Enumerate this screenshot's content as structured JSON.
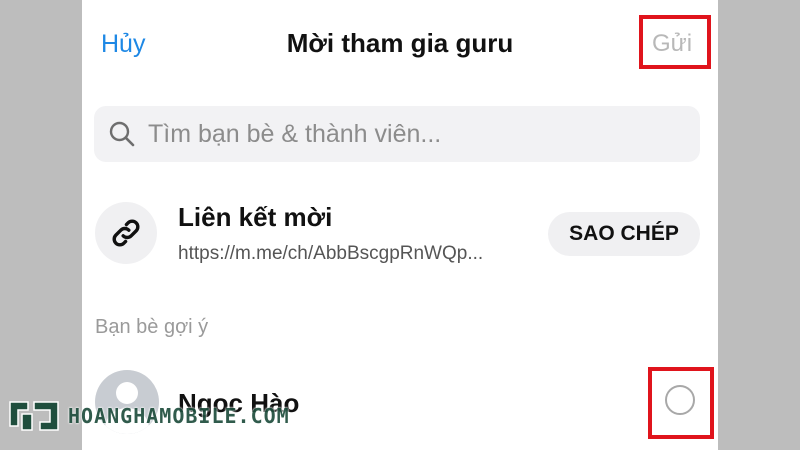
{
  "header": {
    "cancel_label": "Hủy",
    "title": "Mời tham gia guru",
    "send_label": "Gửi"
  },
  "search": {
    "placeholder": "Tìm bạn bè & thành viên..."
  },
  "invite_link": {
    "title": "Liên kết mời",
    "url": "https://m.me/ch/AbbBscgpRnWQp...",
    "copy_label": "SAO CHÉP",
    "icon": "link-icon"
  },
  "suggestions": {
    "section_label": "Bạn bè gợi ý",
    "friends": [
      {
        "name": "Ngoc Hào",
        "selected": false
      }
    ]
  },
  "watermark": {
    "text": "HOANGHAMOBILE.COM"
  },
  "colors": {
    "accent": "#1e88e5",
    "highlight": "#e0141c",
    "disabled": "#b8b8b8",
    "watermark": "#1f4e3d"
  }
}
